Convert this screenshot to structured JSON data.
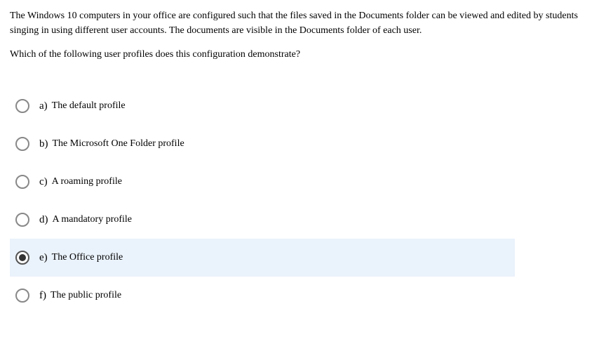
{
  "question": {
    "text": "The Windows 10 computers in your office are configured such that the files saved in the Documents folder can be viewed and edited by students singing in using different user accounts. The documents are visible in the Documents folder of each user.",
    "prompt": "Which of the following user profiles does this configuration demonstrate?"
  },
  "options": [
    {
      "letter": "a)",
      "text": "The default profile",
      "selected": false
    },
    {
      "letter": "b)",
      "text": "The Microsoft One Folder profile",
      "selected": false
    },
    {
      "letter": "c)",
      "text": "A roaming profile",
      "selected": false
    },
    {
      "letter": "d)",
      "text": "A mandatory profile",
      "selected": false
    },
    {
      "letter": "e)",
      "text": "The Office profile",
      "selected": true
    },
    {
      "letter": "f)",
      "text": "The public profile",
      "selected": false
    }
  ]
}
